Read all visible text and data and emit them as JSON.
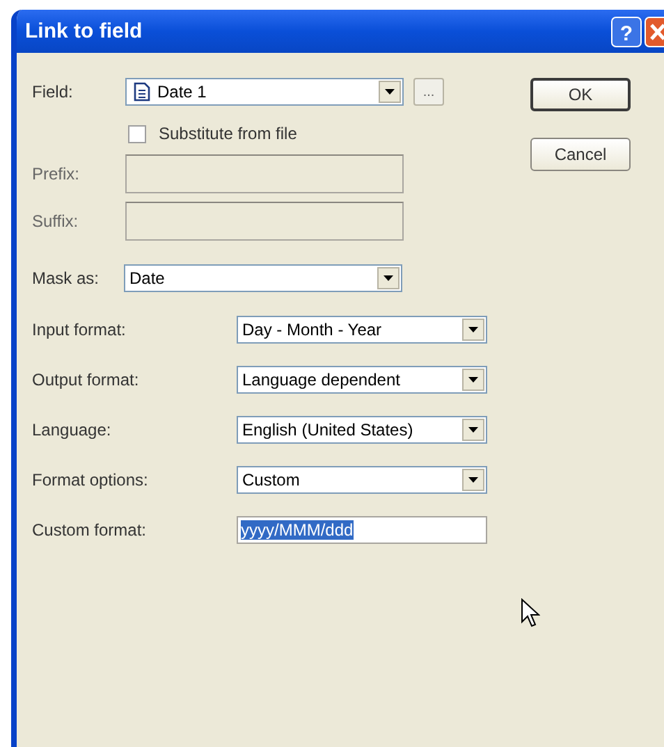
{
  "window": {
    "title": "Link to field",
    "help_button": "?"
  },
  "field": {
    "label": "Field:",
    "value": "Date 1",
    "browse": "..."
  },
  "substitute": {
    "label": "Substitute from file",
    "checked": false
  },
  "affixes": [
    {
      "label": "Prefix:",
      "disabled": true
    },
    {
      "label": "Suffix:",
      "disabled": true
    }
  ],
  "mask": {
    "label": "Mask as:",
    "value": "Date"
  },
  "format_rows": [
    {
      "kind": "dropdown",
      "label": "Input format:",
      "value": "Day - Month - Year"
    },
    {
      "kind": "dropdown",
      "label": "Output format:",
      "value": "Language dependent"
    },
    {
      "kind": "dropdown",
      "label": "Language:",
      "value": "English (United States)"
    },
    {
      "kind": "dropdown",
      "label": "Format options:",
      "value": "Custom"
    },
    {
      "kind": "text",
      "label": "Custom format:",
      "value": "yyyy/MMM/ddd",
      "selected": true
    }
  ],
  "buttons": [
    {
      "label": "OK",
      "default": true
    },
    {
      "label": "Cancel",
      "default": false
    }
  ]
}
